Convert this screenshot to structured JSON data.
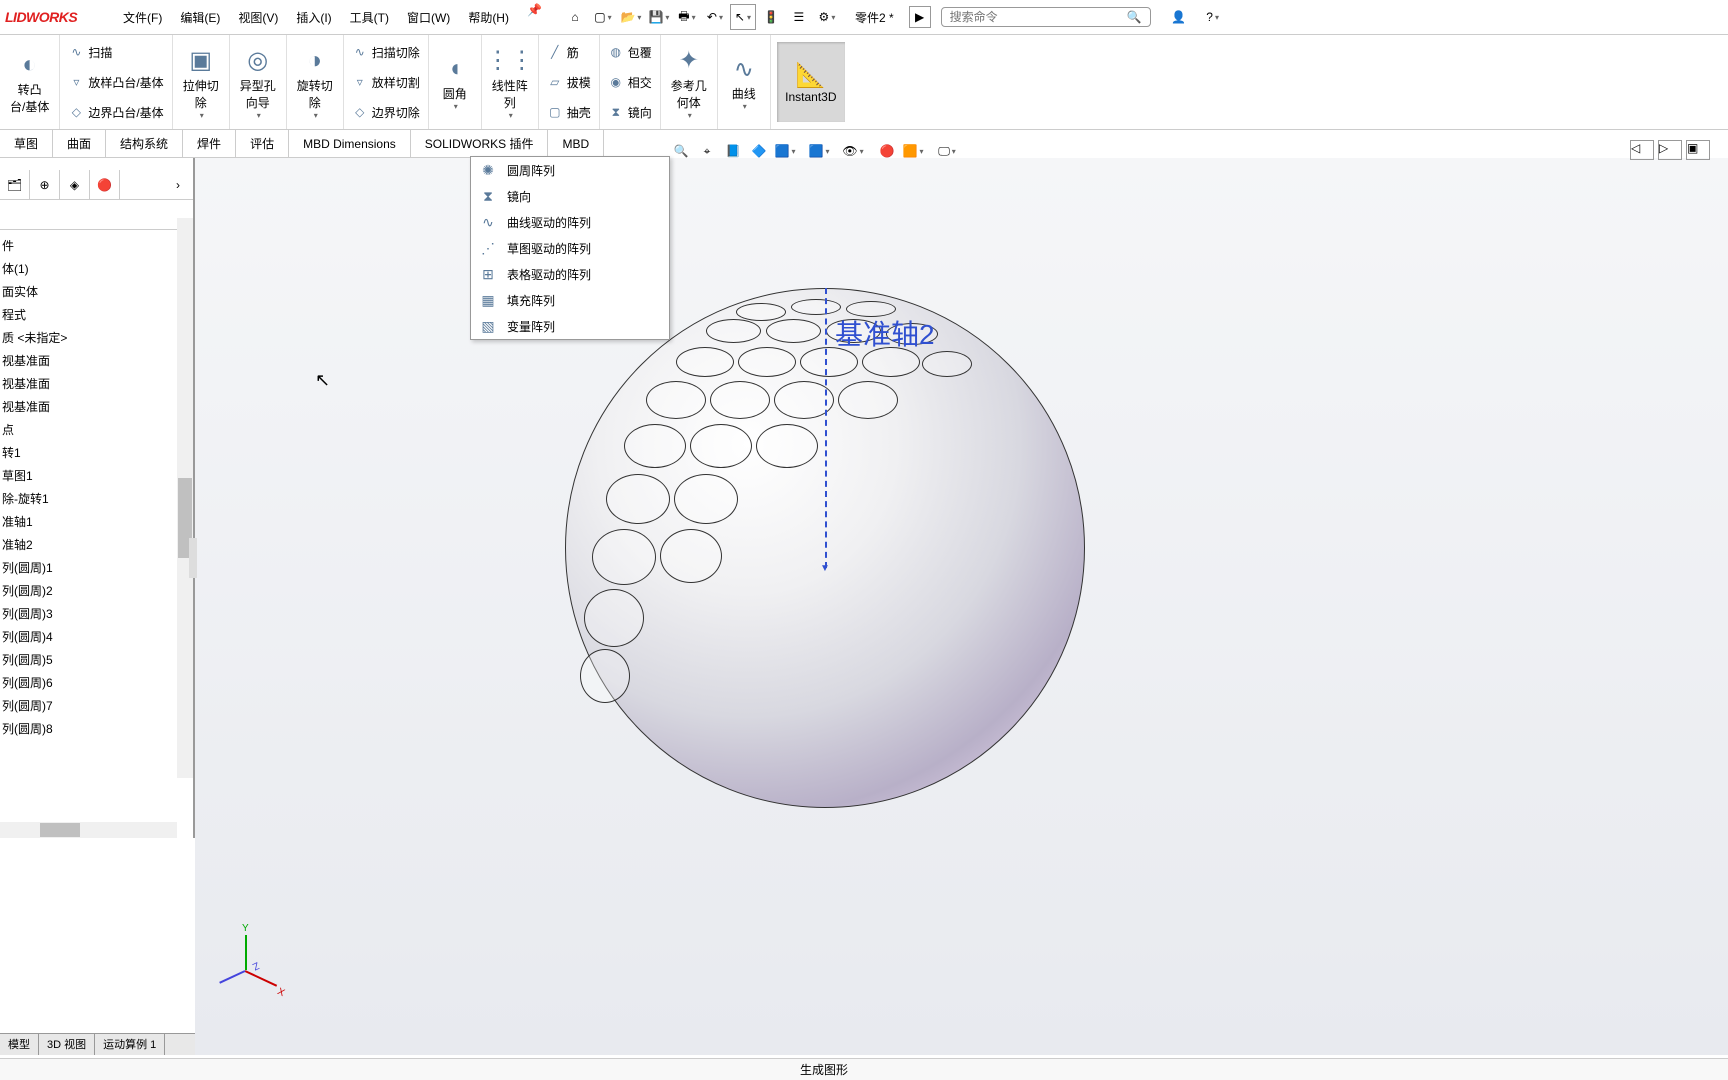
{
  "app": {
    "logo": "LIDWORKS"
  },
  "menu": [
    "文件(F)",
    "编辑(E)",
    "视图(V)",
    "插入(I)",
    "工具(T)",
    "窗口(W)",
    "帮助(H)"
  ],
  "doc_name": "零件2 *",
  "search_placeholder": "搜索命令",
  "ribbon": {
    "col1": {
      "top": "转凸\n台/基体"
    },
    "col2": [
      "扫描",
      "放样凸台/基体",
      "边界凸台/基体"
    ],
    "col3": "拉伸切\n除",
    "col4": "异型孔\n向导",
    "col5": "旋转切\n除",
    "col6": [
      "扫描切除",
      "放样切割",
      "边界切除"
    ],
    "col7": "圆角",
    "col8": "线性阵\n列",
    "col9": [
      "筋",
      "拔模",
      "抽壳"
    ],
    "col10": [
      "包覆",
      "相交",
      "镜向"
    ],
    "col11": "参考几\n何体",
    "col12": "曲线",
    "col13": "Instant3D"
  },
  "subtabs": [
    "草图",
    "曲面",
    "结构系统",
    "焊件",
    "评估",
    "MBD Dimensions",
    "SOLIDWORKS 插件",
    "MBD"
  ],
  "dropdown": [
    "圆周阵列",
    "镜向",
    "曲线驱动的阵列",
    "草图驱动的阵列",
    "表格驱动的阵列",
    "填充阵列",
    "变量阵列"
  ],
  "tree": [
    "件",
    "体(1)",
    "面实体",
    "程式",
    "质 <未指定>",
    "视基准面",
    "视基准面",
    "视基准面",
    "点",
    "转1",
    "草图1",
    "除-旋转1",
    "准轴1",
    "准轴2",
    "列(圆周)1",
    "列(圆周)2",
    "列(圆周)3",
    "列(圆周)4",
    "列(圆周)5",
    "列(圆周)6",
    "列(圆周)7",
    "列(圆周)8"
  ],
  "axis_label": "基准轴2",
  "bottom_tabs": [
    "模型",
    "3D 视图",
    "运动算例 1"
  ],
  "status": "生成图形"
}
